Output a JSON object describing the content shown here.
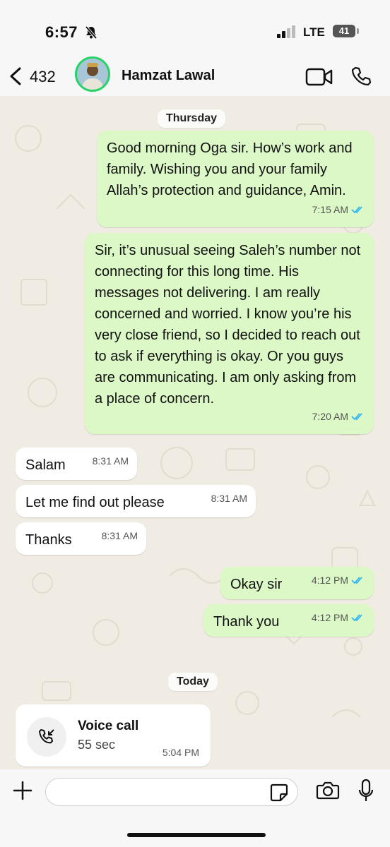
{
  "status_bar": {
    "time": "6:57",
    "network": "LTE",
    "battery": "41"
  },
  "header": {
    "back_count": "432",
    "contact_name": "Hamzat Lawal",
    "accent": "#25d366"
  },
  "chat": {
    "day_labels": [
      "Thursday",
      "Today"
    ],
    "messages": [
      {
        "dir": "out",
        "text": "Good morning Oga sir. How’s work and family. Wishing you and your family Allah’s protection and guidance, Amin.",
        "time": "7:15 AM",
        "read": true
      },
      {
        "dir": "out",
        "text": "Sir, it’s unusual seeing Saleh’s number not connecting for this long time. His messages not delivering. I am really concerned and worried. I know you’re his very close friend, so I decided to reach out to ask if everything is okay. Or you guys are communicating. I am only asking from a place of concern.",
        "time": "7:20 AM",
        "read": true
      },
      {
        "dir": "in",
        "text": "Salam",
        "time": "8:31 AM"
      },
      {
        "dir": "in",
        "text": "Let me find out please",
        "time": "8:31 AM"
      },
      {
        "dir": "in",
        "text": "Thanks",
        "time": "8:31 AM"
      },
      {
        "dir": "out",
        "text": "Okay sir",
        "time": "4:12 PM",
        "read": true
      },
      {
        "dir": "out",
        "text": "Thank you",
        "time": "4:12 PM",
        "read": true
      }
    ],
    "voice_call": {
      "title": "Voice call",
      "duration": "55 sec",
      "time": "5:04 PM"
    }
  },
  "colors": {
    "outgoing_bubble": "#dcf8c6",
    "incoming_bubble": "#ffffff",
    "read_ticks": "#34b7f1"
  },
  "icons": [
    "bell-slash-icon",
    "signal-icon",
    "back-chevron-icon",
    "video-call-icon",
    "phone-icon",
    "incoming-call-icon",
    "plus-icon",
    "sticker-icon",
    "camera-icon",
    "mic-icon"
  ]
}
